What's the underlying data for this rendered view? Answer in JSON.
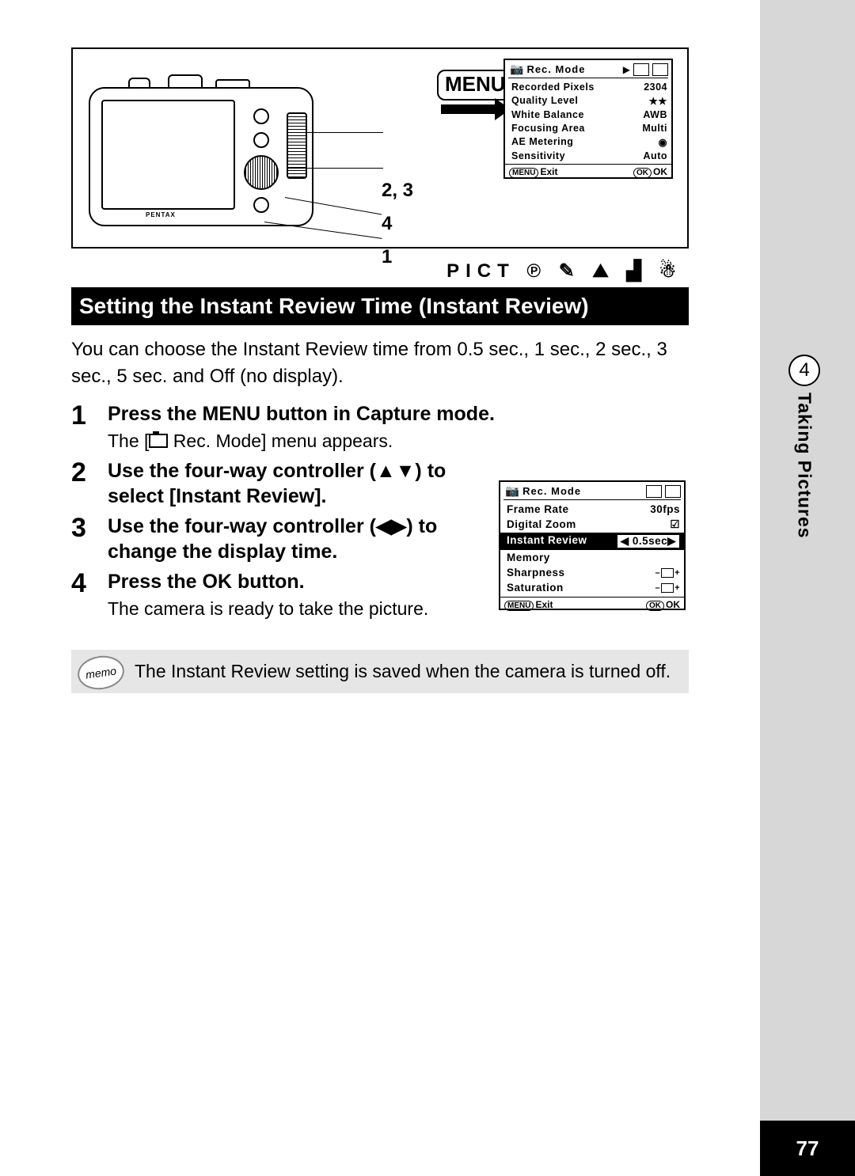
{
  "page_number": "77",
  "sidebar": {
    "chapter_num": "4",
    "chapter_title": "Taking Pictures"
  },
  "diagram": {
    "menu_button": "MENU",
    "callouts": {
      "c1": "2, 3",
      "c2": "4",
      "c3": "1"
    }
  },
  "menu_screen_top": {
    "title": "Rec. Mode",
    "rows": [
      {
        "label": "Recorded Pixels",
        "value": "2304"
      },
      {
        "label": "Quality Level",
        "value": "★★"
      },
      {
        "label": "White Balance",
        "value": "AWB"
      },
      {
        "label": "Focusing Area",
        "value": "Multi"
      },
      {
        "label": "AE Metering",
        "value": "◉"
      },
      {
        "label": "Sensitivity",
        "value": "Auto"
      }
    ],
    "footer": {
      "left_btn": "MENU",
      "left": "Exit",
      "right_btn": "OK",
      "right": "OK"
    }
  },
  "mode_row": "PICT  ℗  ✎  ⛰  ▟  ☃",
  "section_title": "Setting the Instant Review Time (Instant Review)",
  "intro": "You can choose the Instant Review time from 0.5 sec., 1 sec., 2 sec., 3 sec., 5 sec. and Off (no display).",
  "steps": [
    {
      "num": "1",
      "title": "Press the MENU button in Capture mode.",
      "sub_pre": "The [",
      "sub_post": " Rec. Mode] menu appears."
    },
    {
      "num": "2",
      "title": "Use the four-way controller (▲▼) to select [Instant Review]."
    },
    {
      "num": "3",
      "title": "Use the four-way controller (◀▶) to change the display time."
    },
    {
      "num": "4",
      "title": "Press the OK button.",
      "sub": "The camera is ready to take the picture."
    }
  ],
  "menu_screen_body": {
    "title": "Rec. Mode",
    "rows": [
      {
        "label": "Frame Rate",
        "value": "30fps"
      },
      {
        "label": "Digital Zoom",
        "value": "☑"
      },
      {
        "label": "Instant Review",
        "value": "0.5sec",
        "highlight": true,
        "arrows": true
      },
      {
        "label": "Memory",
        "value": ""
      },
      {
        "label": "Sharpness",
        "value": "slider"
      },
      {
        "label": "Saturation",
        "value": "slider"
      }
    ],
    "footer": {
      "left_btn": "MENU",
      "left": "Exit",
      "right_btn": "OK",
      "right": "OK"
    }
  },
  "memo": {
    "icon": "memo",
    "text": "The Instant Review setting is saved when the camera is turned off."
  }
}
